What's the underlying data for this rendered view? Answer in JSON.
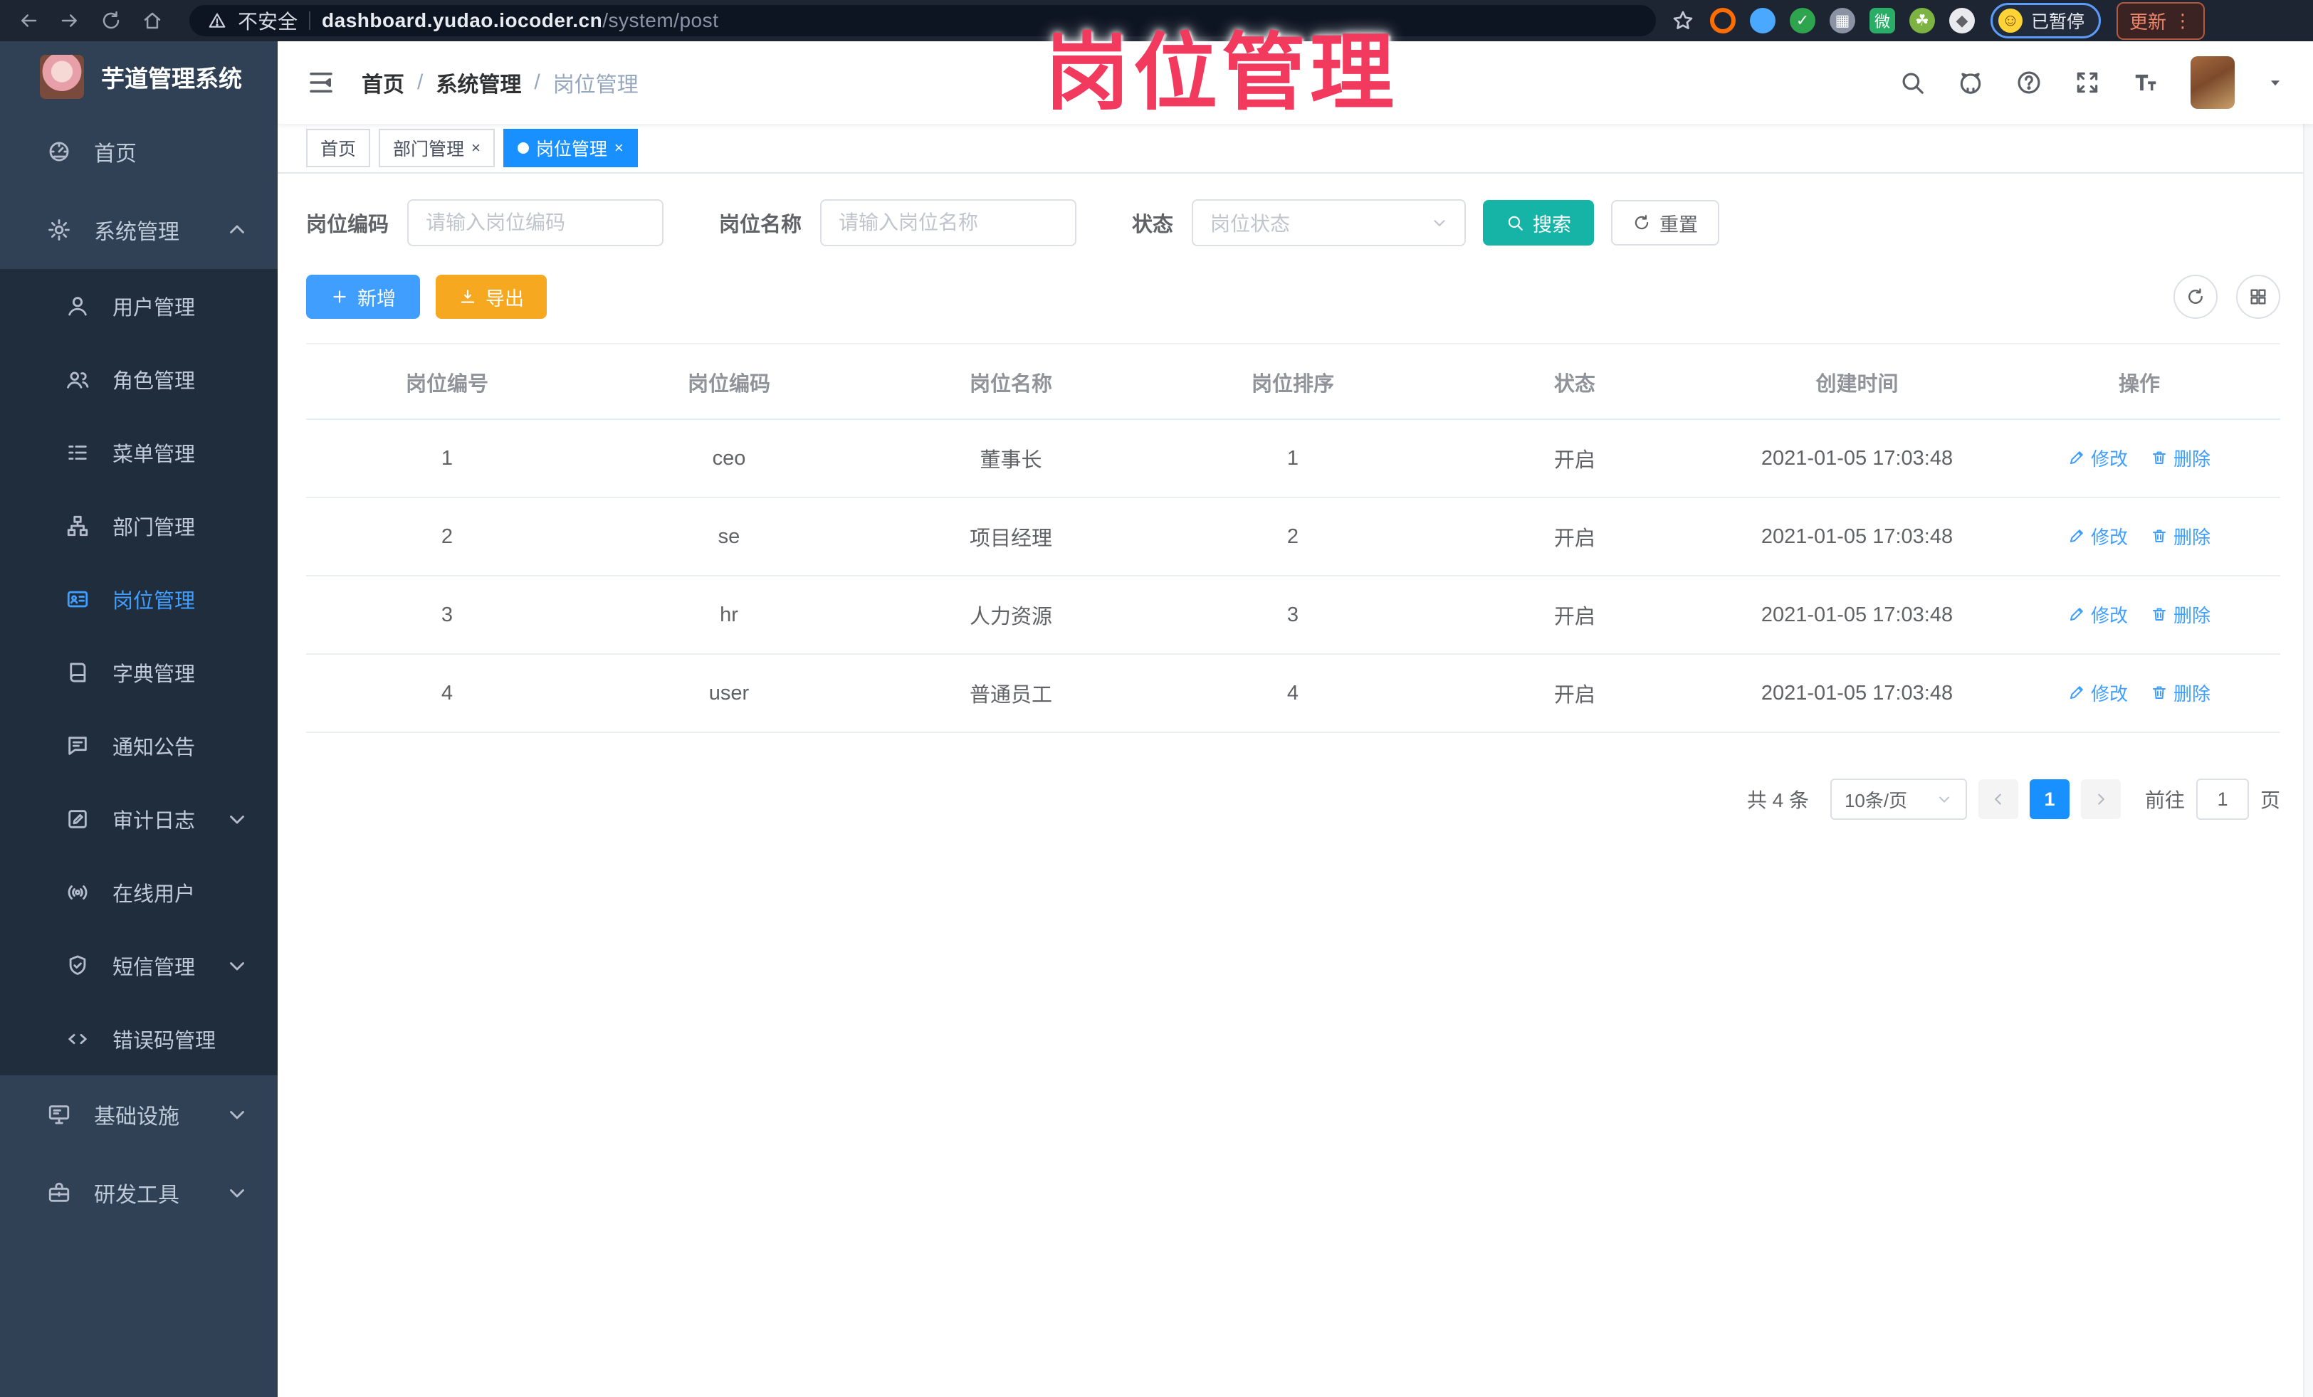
{
  "overlay": {
    "title": "岗位管理",
    "color": "#f23a5f"
  },
  "browser": {
    "security_label": "不安全",
    "url_host": "dashboard.yudao.iocoder.cn",
    "url_path": "/system/post",
    "paused_badge": "已暂停",
    "update_label": "更新",
    "extensions": [
      {
        "name": "extension-orange-ring-icon",
        "color": "#ff6d00",
        "style": "ring",
        "glyph": ""
      },
      {
        "name": "extension-blue-drop-icon",
        "color": "#4aa8ff",
        "style": "circle",
        "glyph": ""
      },
      {
        "name": "extension-green-check-icon",
        "color": "#2ea44f",
        "style": "circle",
        "glyph": "✓"
      },
      {
        "name": "extension-gray-grid-icon",
        "color": "#8a93a3",
        "style": "circle",
        "glyph": "▦"
      },
      {
        "name": "extension-wechat-icon",
        "color": "#2aae67",
        "style": "square",
        "glyph": "微"
      },
      {
        "name": "extension-leaf-icon",
        "color": "#7cb342",
        "style": "circle",
        "glyph": "☘"
      },
      {
        "name": "extensions-puzzle-icon",
        "color": "#e8eaed",
        "style": "circle",
        "glyph": "◆"
      }
    ]
  },
  "sidebar": {
    "logo_title": "芋道管理系统",
    "top_items": [
      {
        "key": "home",
        "label": "首页",
        "icon": "dashboard"
      },
      {
        "key": "system-management",
        "label": "系统管理",
        "icon": "gear",
        "arrow": "up"
      }
    ],
    "sub_items": [
      {
        "key": "user-management",
        "label": "用户管理",
        "icon": "user"
      },
      {
        "key": "role-management",
        "label": "角色管理",
        "icon": "users"
      },
      {
        "key": "menu-management",
        "label": "菜单管理",
        "icon": "menulist"
      },
      {
        "key": "dept-management",
        "label": "部门管理",
        "icon": "orgtree"
      },
      {
        "key": "post-management",
        "label": "岗位管理",
        "icon": "postcard",
        "active": true
      },
      {
        "key": "dict-management",
        "label": "字典管理",
        "icon": "dict"
      },
      {
        "key": "notice-announcement",
        "label": "通知公告",
        "icon": "announce"
      },
      {
        "key": "audit-log",
        "label": "审计日志",
        "icon": "audit",
        "arrow": "down"
      },
      {
        "key": "online-users",
        "label": "在线用户",
        "icon": "online"
      },
      {
        "key": "sms-management",
        "label": "短信管理",
        "icon": "sms",
        "arrow": "down"
      },
      {
        "key": "error-code-management",
        "label": "错误码管理",
        "icon": "code"
      }
    ],
    "bottom_items": [
      {
        "key": "infrastructure",
        "label": "基础设施",
        "icon": "infra",
        "arrow": "down"
      },
      {
        "key": "dev-tools",
        "label": "研发工具",
        "icon": "tools",
        "arrow": "down"
      }
    ]
  },
  "header": {
    "breadcrumb": [
      "首页",
      "系统管理",
      "岗位管理"
    ]
  },
  "tabs": [
    {
      "key": "home",
      "label": "首页",
      "closable": false,
      "active": false
    },
    {
      "key": "dept-management",
      "label": "部门管理",
      "closable": true,
      "active": false
    },
    {
      "key": "post-management",
      "label": "岗位管理",
      "closable": true,
      "active": true
    }
  ],
  "filters": {
    "post_code_label": "岗位编码",
    "post_code_placeholder": "请输入岗位编码",
    "post_name_label": "岗位名称",
    "post_name_placeholder": "请输入岗位名称",
    "status_label": "状态",
    "status_placeholder": "岗位状态",
    "search_label": "搜索",
    "reset_label": "重置"
  },
  "toolbar": {
    "add_label": "新增",
    "export_label": "导出"
  },
  "table": {
    "columns": [
      "岗位编号",
      "岗位编码",
      "岗位名称",
      "岗位排序",
      "状态",
      "创建时间",
      "操作"
    ],
    "rows": [
      {
        "id": "1",
        "code": "ceo",
        "name": "董事长",
        "sort": "1",
        "status": "开启",
        "created": "2021-01-05 17:03:48"
      },
      {
        "id": "2",
        "code": "se",
        "name": "项目经理",
        "sort": "2",
        "status": "开启",
        "created": "2021-01-05 17:03:48"
      },
      {
        "id": "3",
        "code": "hr",
        "name": "人力资源",
        "sort": "3",
        "status": "开启",
        "created": "2021-01-05 17:03:48"
      },
      {
        "id": "4",
        "code": "user",
        "name": "普通员工",
        "sort": "4",
        "status": "开启",
        "created": "2021-01-05 17:03:48"
      }
    ],
    "edit_label": "修改",
    "delete_label": "删除"
  },
  "pagination": {
    "total_label": "共 4 条",
    "page_size": "10条/页",
    "current_page": "1",
    "goto_label": "前往",
    "goto_value": "1",
    "page_unit": "页"
  },
  "colors": {
    "accent_blue": "#409eff",
    "active_tab_blue": "#1890ff",
    "search_teal": "#16b3a7",
    "export_orange": "#f6a821",
    "sidebar_bg": "#304156",
    "submenu_bg": "#1f2d3d",
    "overlay_pink": "#f23a5f"
  }
}
